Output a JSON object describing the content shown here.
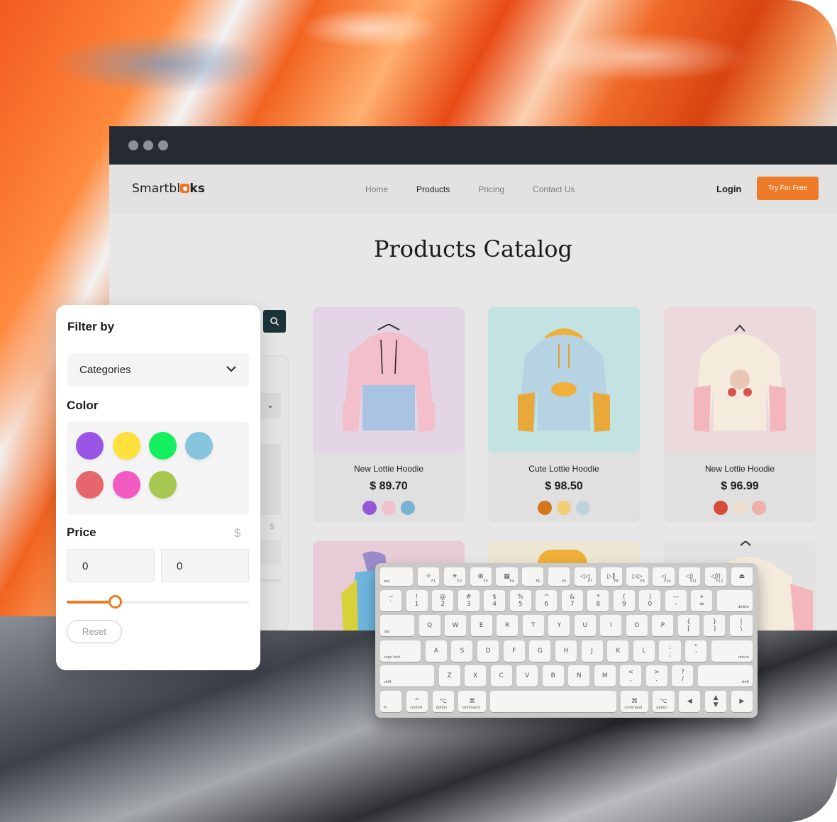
{
  "browser": {
    "logo": {
      "text_pre": "Smartbl",
      "text_post": "ks"
    },
    "nav": [
      {
        "label": "Home",
        "active": false
      },
      {
        "label": "Products",
        "active": true
      },
      {
        "label": "Pricing",
        "active": false
      },
      {
        "label": "Contact Us",
        "active": false
      }
    ],
    "login_label": "Login",
    "try_label": "Try For Free",
    "page_title": "Products Catalog"
  },
  "products": [
    {
      "name": "New Lottie Hoodie",
      "price": "$ 89.70",
      "bg": "#e3d5e5",
      "colors": [
        "#9558d7",
        "#f0c0cc",
        "#79b2d3"
      ]
    },
    {
      "name": "Cute Lottie Hoodie",
      "price": "$ 98.50",
      "bg": "#c3e2e2",
      "colors": [
        "#d2771c",
        "#f0cf76",
        "#bdd4dc"
      ]
    },
    {
      "name": "New Lottie Hoodie",
      "price": "$ 96.99",
      "bg": "#ecd9db",
      "colors": [
        "#d84a3a",
        "#eedfcc",
        "#eeb0a8"
      ]
    }
  ],
  "filter": {
    "title": "Filter by",
    "category_label": "Categories",
    "color_label": "Color",
    "colors": [
      "#9a55e6",
      "#ffe03c",
      "#14ef5e",
      "#87c4dd",
      "#e6676b",
      "#f25ac2",
      "#a6c850"
    ],
    "price_label": "Price",
    "price_symbol": "$",
    "price_min": "0",
    "price_max": "0",
    "slider_fraction": 0.27,
    "reset_label": "Reset"
  },
  "keyboard": {
    "rows": [
      [
        {
          "t": "",
          "bl": "esc"
        },
        {
          "t": "☼",
          "br": "F1"
        },
        {
          "t": "☀",
          "br": "F2"
        },
        {
          "t": "⊞",
          "br": "F3"
        },
        {
          "t": "▦",
          "br": "F4"
        },
        {
          "t": "",
          "br": "F5"
        },
        {
          "t": "",
          "br": "F6"
        },
        {
          "t": "◁◁",
          "br": "F7"
        },
        {
          "t": "▷‖",
          "br": "F8"
        },
        {
          "t": "▷▷",
          "br": "F9"
        },
        {
          "t": "◁",
          "br": "F10"
        },
        {
          "t": "◁)",
          "br": "F11"
        },
        {
          "t": "◁))",
          "br": "F12"
        },
        {
          "t": "⏏"
        }
      ],
      [
        {
          "t": "~\n`"
        },
        {
          "t": "!\n1"
        },
        {
          "t": "@\n2"
        },
        {
          "t": "#\n3"
        },
        {
          "t": "$\n4"
        },
        {
          "t": "%\n5"
        },
        {
          "t": "^\n6"
        },
        {
          "t": "&\n7"
        },
        {
          "t": "*\n8"
        },
        {
          "t": "(\n9"
        },
        {
          "t": ")\n0"
        },
        {
          "t": "—\n-"
        },
        {
          "t": "+\n="
        },
        {
          "t": "",
          "br": "delete"
        }
      ],
      [
        {
          "t": "",
          "bl": "tab"
        },
        {
          "t": "Q"
        },
        {
          "t": "W"
        },
        {
          "t": "E"
        },
        {
          "t": "R"
        },
        {
          "t": "T"
        },
        {
          "t": "Y"
        },
        {
          "t": "U"
        },
        {
          "t": "I"
        },
        {
          "t": "O"
        },
        {
          "t": "P"
        },
        {
          "t": "{\n["
        },
        {
          "t": "}\n]"
        },
        {
          "t": "|\n\\"
        }
      ],
      [
        {
          "t": "",
          "bl": "caps lock"
        },
        {
          "t": "A"
        },
        {
          "t": "S"
        },
        {
          "t": "D"
        },
        {
          "t": "F"
        },
        {
          "t": "G"
        },
        {
          "t": "H"
        },
        {
          "t": "J"
        },
        {
          "t": "K"
        },
        {
          "t": "L"
        },
        {
          "t": ":\n;"
        },
        {
          "t": "\"\n'"
        },
        {
          "t": "",
          "br": "return"
        }
      ],
      [
        {
          "t": "",
          "bl": "shift"
        },
        {
          "t": "Z"
        },
        {
          "t": "X"
        },
        {
          "t": "C"
        },
        {
          "t": "V"
        },
        {
          "t": "B"
        },
        {
          "t": "N"
        },
        {
          "t": "M"
        },
        {
          "t": "<\n,"
        },
        {
          "t": ">\n."
        },
        {
          "t": "?\n/"
        },
        {
          "t": "",
          "br": "shift"
        }
      ],
      [
        {
          "t": "",
          "bl": "fn"
        },
        {
          "t": "^",
          "bl": "control"
        },
        {
          "t": "⌥",
          "bl": "option"
        },
        {
          "t": "⌘",
          "bl": "command"
        },
        {
          "t": ""
        },
        {
          "t": "⌘",
          "bl": "command"
        },
        {
          "t": "⌥",
          "bl": "option"
        },
        {
          "t": "◀"
        },
        {
          "t": "▲\n▼"
        },
        {
          "t": "▶"
        }
      ]
    ]
  }
}
